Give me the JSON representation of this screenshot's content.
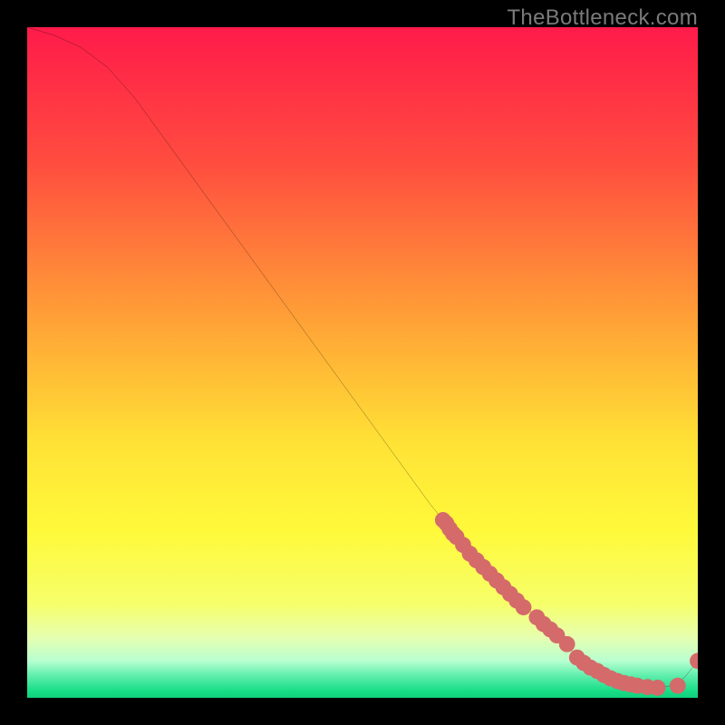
{
  "watermark": "TheBottleneck.com",
  "chart_data": {
    "type": "line",
    "title": "",
    "xlabel": "",
    "ylabel": "",
    "xlim": [
      0,
      100
    ],
    "ylim": [
      0,
      100
    ],
    "gradient_stops": [
      {
        "offset": 0,
        "color": "#ff1b4a"
      },
      {
        "offset": 20,
        "color": "#ff4c3f"
      },
      {
        "offset": 45,
        "color": "#ffa636"
      },
      {
        "offset": 62,
        "color": "#ffe236"
      },
      {
        "offset": 75,
        "color": "#fff93a"
      },
      {
        "offset": 86,
        "color": "#f6ff6a"
      },
      {
        "offset": 91,
        "color": "#e6ffb0"
      },
      {
        "offset": 94.5,
        "color": "#b8ffd0"
      },
      {
        "offset": 96.5,
        "color": "#66f0b0"
      },
      {
        "offset": 99,
        "color": "#17dd86"
      },
      {
        "offset": 100,
        "color": "#0fd07e"
      }
    ],
    "series": [
      {
        "name": "bottleneck-curve",
        "color": "#000000",
        "x": [
          0,
          4,
          8,
          12,
          16,
          20,
          24,
          28,
          32,
          36,
          40,
          44,
          48,
          52,
          56,
          60,
          64,
          68,
          72,
          76,
          80,
          82,
          85,
          88,
          91,
          94,
          96,
          98,
          100
        ],
        "y": [
          100,
          98.8,
          97.0,
          94.0,
          89.5,
          84.0,
          78.5,
          73.0,
          67.5,
          62.0,
          56.5,
          51.0,
          45.5,
          40.0,
          34.5,
          29.0,
          24.0,
          19.5,
          15.5,
          12.0,
          8.5,
          6.0,
          4.0,
          2.5,
          1.8,
          1.5,
          1.8,
          3.0,
          5.5
        ]
      }
    ],
    "markers": {
      "name": "data-points",
      "color": "#d46a6a",
      "radius": 1.2,
      "x": [
        62,
        62.5,
        63,
        63.5,
        64,
        65,
        66,
        67,
        68,
        69,
        70,
        71,
        72,
        73,
        74,
        76,
        77,
        78,
        79,
        80.5,
        82,
        83,
        84,
        85,
        86,
        87,
        88,
        89,
        90,
        91,
        92.5,
        94,
        97,
        100
      ],
      "y": [
        26.5,
        26.0,
        25.2,
        24.5,
        24.0,
        22.8,
        21.5,
        20.5,
        19.5,
        18.5,
        17.5,
        16.5,
        15.5,
        14.5,
        13.5,
        12.0,
        11.0,
        10.2,
        9.3,
        8.0,
        6.0,
        5.2,
        4.5,
        4.0,
        3.4,
        2.9,
        2.5,
        2.2,
        2.0,
        1.8,
        1.6,
        1.5,
        1.8,
        5.5
      ]
    }
  }
}
